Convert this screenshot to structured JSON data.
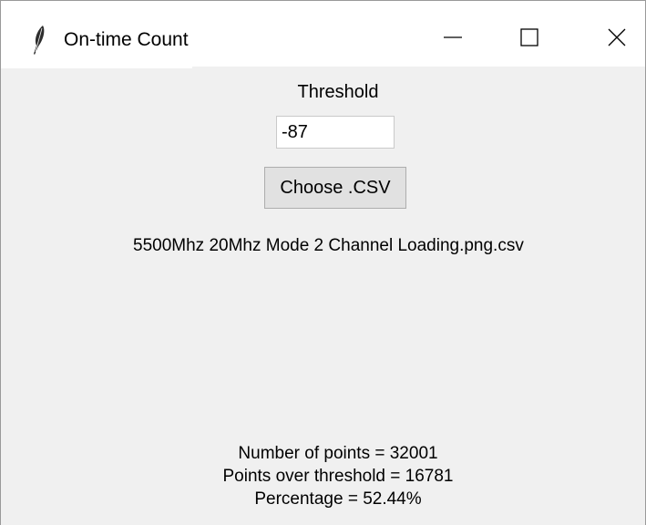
{
  "window": {
    "title": "On-time Count",
    "icon": "feather-icon",
    "controls": {
      "minimize_icon": "minimize-icon",
      "maximize_icon": "maximize-icon",
      "close_icon": "close-icon"
    }
  },
  "form": {
    "threshold_label": "Threshold",
    "threshold_value": "-87",
    "choose_button_label": "Choose .CSV",
    "selected_file": "5500Mhz 20Mhz Mode 2 Channel Loading.png.csv"
  },
  "results": {
    "points_line": "Number of points = 32001",
    "over_threshold_line": "Points over threshold = 16781",
    "percentage_line": "Percentage = 52.44%"
  },
  "colors": {
    "titlebar": "#ffffff",
    "client_area": "#f0f0f0",
    "button_face": "#e1e1e1",
    "button_border": "#adadad"
  }
}
